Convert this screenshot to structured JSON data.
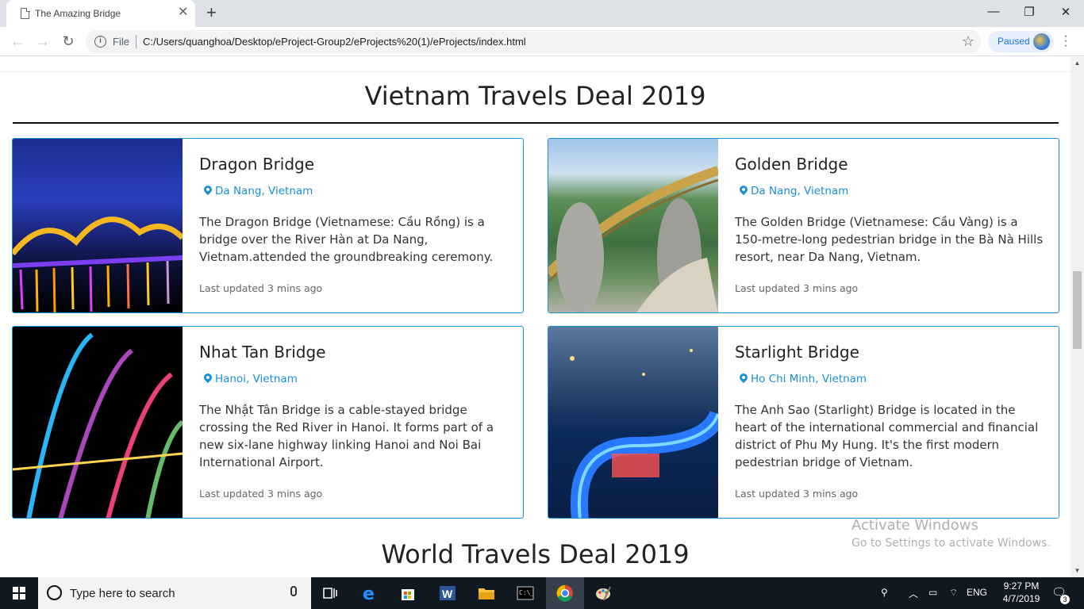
{
  "browser": {
    "tab_title": "The Amazing Bridge",
    "file_label": "File",
    "url": "C:/Users/quanghoa/Desktop/eProject-Group2/eProjects%20(1)/eProjects/index.html",
    "profile_status": "Paused"
  },
  "page": {
    "section_title": "Vietnam Travels Deal 2019",
    "next_section_title": "World Travels Deal 2019",
    "cards": [
      {
        "title": "Dragon Bridge",
        "location": "Da Nang, Vietnam",
        "description": "The Dragon Bridge (Vietnamese: Cầu Rồng) is a bridge over the River Hàn at Da Nang, Vietnam.attended the groundbreaking ceremony.",
        "updated": "Last updated 3 mins ago"
      },
      {
        "title": "Golden Bridge",
        "location": "Da Nang, Vietnam",
        "description": "The Golden Bridge (Vietnamese: Cầu Vàng) is a 150-metre-long pedestrian bridge in the Bà Nà Hills resort, near Da Nang, Vietnam.",
        "updated": "Last updated 3 mins ago"
      },
      {
        "title": "Nhat Tan Bridge",
        "location": "Hanoi, Vietnam",
        "description": "The Nhật Tân Bridge is a cable-stayed bridge crossing the Red River in Hanoi. It forms part of a new six-lane highway linking Hanoi and Noi Bai International Airport.",
        "updated": "Last updated 3 mins ago"
      },
      {
        "title": "Starlight Bridge",
        "location": "Ho Chi Minh, Vietnam",
        "description": "The Anh Sao (Starlight) Bridge is located in the heart of the international commercial and financial district of Phu My Hung. It's the first modern pedestrian bridge of Vietnam.",
        "updated": "Last updated 3 mins ago"
      }
    ]
  },
  "watermark": {
    "title": "Activate Windows",
    "subtitle": "Go to Settings to activate Windows."
  },
  "taskbar": {
    "search_placeholder": "Type here to search",
    "language": "ENG",
    "time": "9:27 PM",
    "date": "4/7/2019",
    "notification_count": "3"
  },
  "colors": {
    "accent": "#1a8fd6",
    "taskbar": "#101822"
  }
}
